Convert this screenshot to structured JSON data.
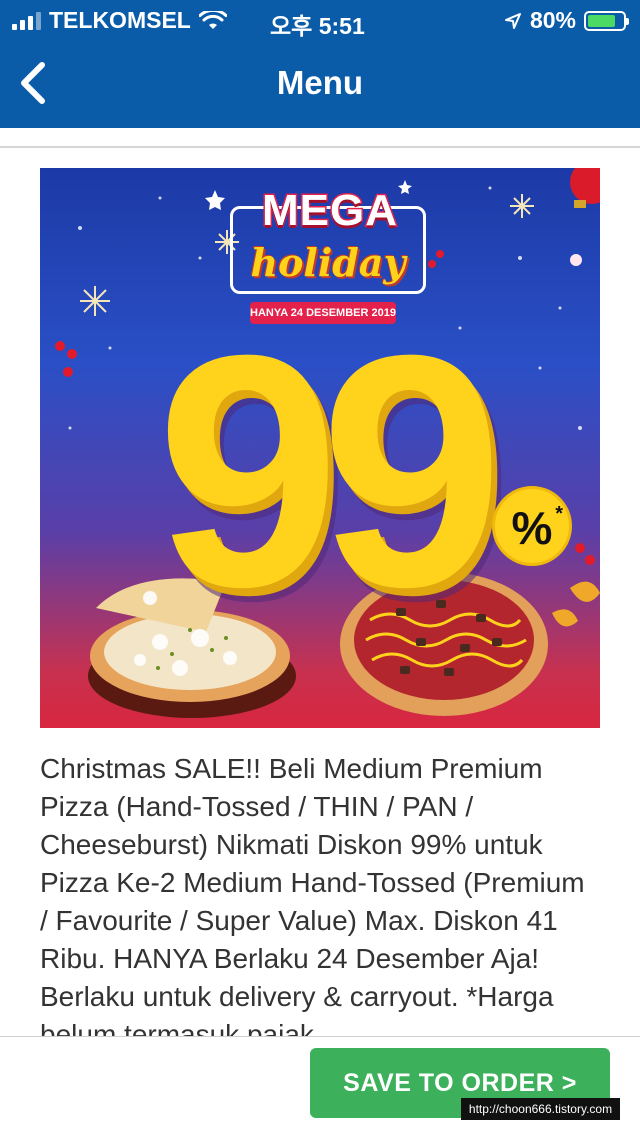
{
  "status_bar": {
    "carrier": "TELKOMSEL",
    "time": "오후 5:51",
    "battery": "80%",
    "battery_level": 0.8
  },
  "nav": {
    "title": "Menu",
    "back_icon": "chevron-left-icon"
  },
  "banner": {
    "headline": "MEGA",
    "subheadline": "holiday",
    "date_text": "HANYA 24 DESEMBER 2019",
    "big_number": "99",
    "percent_text": "%",
    "asterisk": "*"
  },
  "description": "Christmas SALE!! Beli Medium Premium Pizza (Hand-Tossed / THIN / PAN / Cheeseburst) Nikmati Diskon 99% untuk Pizza Ke-2 Medium Hand-Tossed (Premium / Favourite / Super Value) Max. Diskon 41 Ribu. HANYA Berlaku 24 Desember Aja! Berlaku untuk delivery & carryout. *Harga belum termasuk pajak",
  "footer": {
    "order_button": "SAVE TO ORDER >"
  },
  "watermark": "http://choon666.tistory.com",
  "colors": {
    "header": "#0a5ca8",
    "order_button": "#3db05b",
    "banner_yellow": "#ffd31c",
    "banner_red": "#e3214b"
  }
}
